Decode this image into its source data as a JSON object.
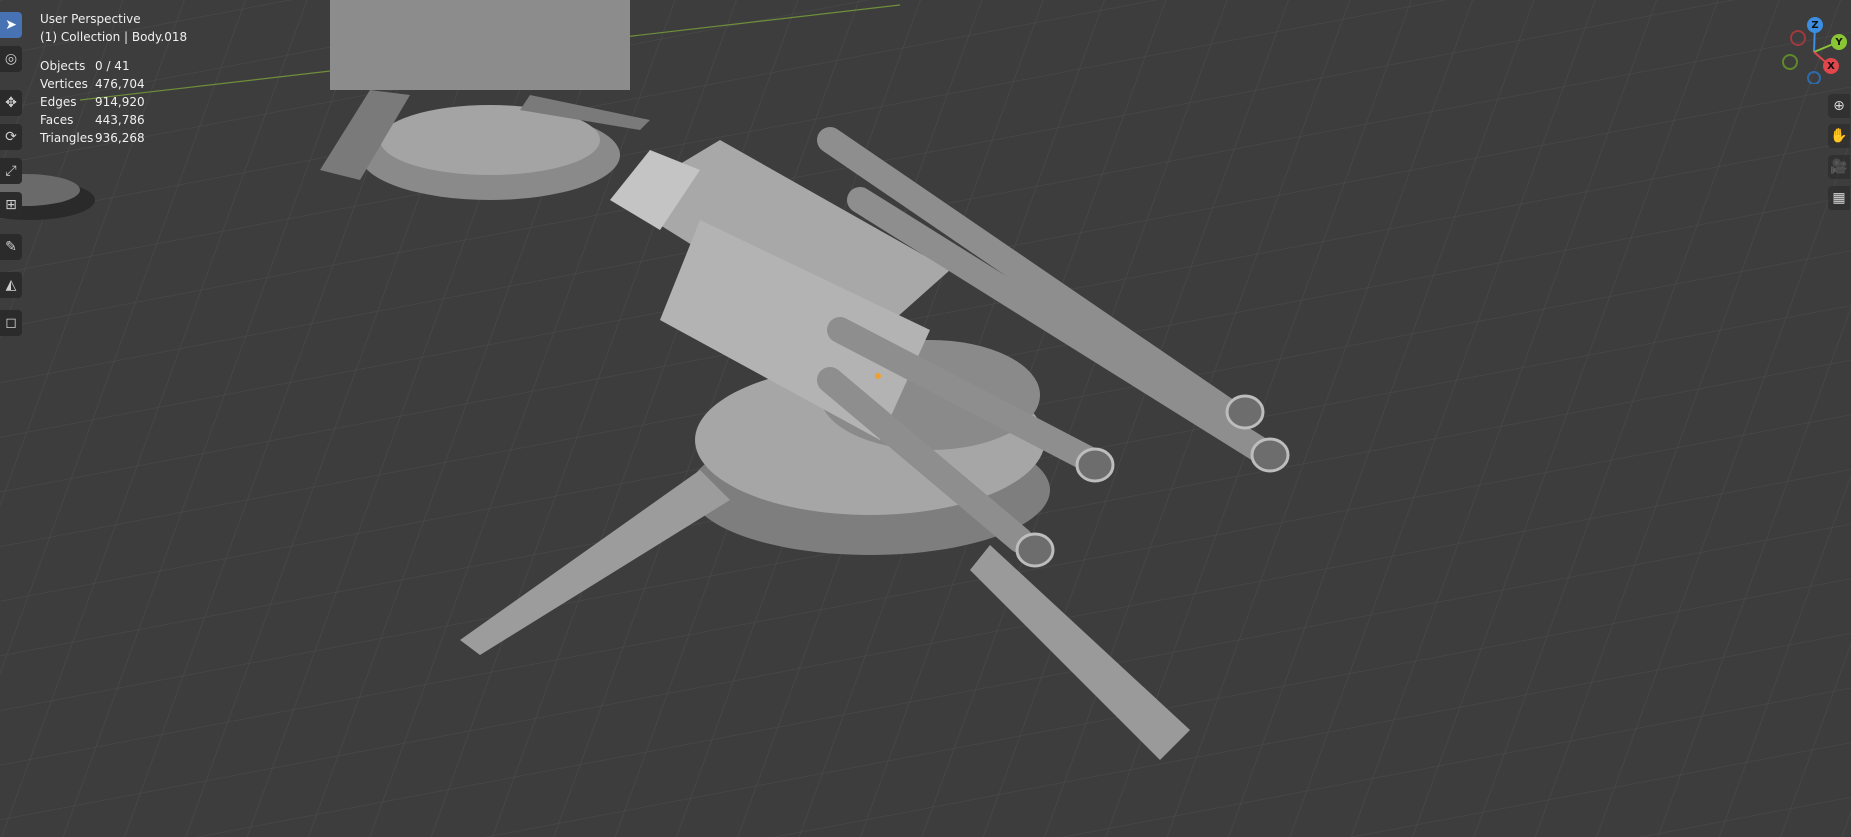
{
  "viewport": {
    "title": "User Perspective",
    "collection": "(1) Collection | Body.018"
  },
  "stats": [
    {
      "label": "Objects",
      "value": "0 / 41"
    },
    {
      "label": "Vertices",
      "value": "476,704"
    },
    {
      "label": "Edges",
      "value": "914,920"
    },
    {
      "label": "Faces",
      "value": "443,786"
    },
    {
      "label": "Triangles",
      "value": "936,268"
    }
  ],
  "toolbar": [
    {
      "name": "select-box-tool",
      "glyph": "➤",
      "active": true
    },
    {
      "name": "cursor-tool",
      "glyph": "◎",
      "active": false
    },
    {
      "name": "move-tool",
      "glyph": "✥",
      "active": false
    },
    {
      "name": "rotate-tool",
      "glyph": "⟳",
      "active": false
    },
    {
      "name": "scale-tool",
      "glyph": "⤢",
      "active": false
    },
    {
      "name": "transform-tool",
      "glyph": "⊞",
      "active": false
    },
    {
      "name": "annotate-tool",
      "glyph": "✎",
      "active": false
    },
    {
      "name": "measure-tool",
      "glyph": "◭",
      "active": false
    },
    {
      "name": "add-cube-tool",
      "glyph": "◻",
      "active": false
    }
  ],
  "gizmo": {
    "z": "Z",
    "y": "Y",
    "x": "X",
    "colors": {
      "x": "#e0464b",
      "y": "#8ac535",
      "z": "#3d8ee0"
    }
  },
  "nav_buttons": [
    {
      "name": "zoom-icon",
      "glyph": "⊕"
    },
    {
      "name": "pan-hand-icon",
      "glyph": "✋"
    },
    {
      "name": "camera-icon",
      "glyph": "🎥"
    },
    {
      "name": "perspective-grid-icon",
      "glyph": "▦"
    }
  ]
}
